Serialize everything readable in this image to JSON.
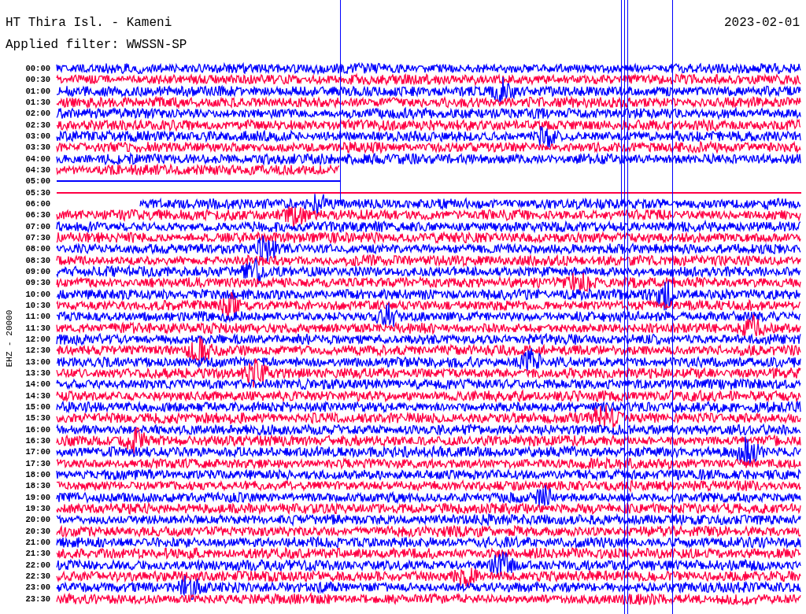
{
  "header": {
    "station": "HT Thira Isl. - Kameni",
    "date": "2023-02-01",
    "filter": "Applied filter: WWSSN-SP"
  },
  "channel_label": "EHZ - 20000",
  "rows": [
    {
      "time": "00:00",
      "color": "#0000ff",
      "kind": "trace"
    },
    {
      "time": "00:30",
      "color": "#ff0044",
      "kind": "trace"
    },
    {
      "time": "01:00",
      "color": "#0000ff",
      "kind": "trace"
    },
    {
      "time": "01:30",
      "color": "#ff0044",
      "kind": "trace"
    },
    {
      "time": "02:00",
      "color": "#0000ff",
      "kind": "trace"
    },
    {
      "time": "02:30",
      "color": "#ff0044",
      "kind": "trace"
    },
    {
      "time": "03:00",
      "color": "#0000ff",
      "kind": "trace"
    },
    {
      "time": "03:30",
      "color": "#ff0044",
      "kind": "trace"
    },
    {
      "time": "04:00",
      "color": "#0000ff",
      "kind": "trace"
    },
    {
      "time": "04:30",
      "color": "#ff0044",
      "kind": "trace"
    },
    {
      "time": "05:00",
      "color": "#0000ff",
      "kind": "flat"
    },
    {
      "time": "05:30",
      "color": "#ff0044",
      "kind": "flat"
    },
    {
      "time": "06:00",
      "color": "#0000ff",
      "kind": "trace"
    },
    {
      "time": "06:30",
      "color": "#ff0044",
      "kind": "trace"
    },
    {
      "time": "07:00",
      "color": "#0000ff",
      "kind": "trace"
    },
    {
      "time": "07:30",
      "color": "#ff0044",
      "kind": "trace"
    },
    {
      "time": "08:00",
      "color": "#0000ff",
      "kind": "trace"
    },
    {
      "time": "08:30",
      "color": "#ff0044",
      "kind": "trace"
    },
    {
      "time": "09:00",
      "color": "#0000ff",
      "kind": "trace"
    },
    {
      "time": "09:30",
      "color": "#ff0044",
      "kind": "trace"
    },
    {
      "time": "10:00",
      "color": "#0000ff",
      "kind": "trace"
    },
    {
      "time": "10:30",
      "color": "#ff0044",
      "kind": "trace"
    },
    {
      "time": "11:00",
      "color": "#0000ff",
      "kind": "trace"
    },
    {
      "time": "11:30",
      "color": "#ff0044",
      "kind": "trace"
    },
    {
      "time": "12:00",
      "color": "#0000ff",
      "kind": "trace"
    },
    {
      "time": "12:30",
      "color": "#ff0044",
      "kind": "trace"
    },
    {
      "time": "13:00",
      "color": "#0000ff",
      "kind": "trace"
    },
    {
      "time": "13:30",
      "color": "#ff0044",
      "kind": "trace"
    },
    {
      "time": "14:00",
      "color": "#0000ff",
      "kind": "trace"
    },
    {
      "time": "14:30",
      "color": "#ff0044",
      "kind": "trace"
    },
    {
      "time": "15:00",
      "color": "#0000ff",
      "kind": "trace"
    },
    {
      "time": "15:30",
      "color": "#ff0044",
      "kind": "trace"
    },
    {
      "time": "16:00",
      "color": "#0000ff",
      "kind": "trace"
    },
    {
      "time": "16:30",
      "color": "#ff0044",
      "kind": "trace"
    },
    {
      "time": "17:00",
      "color": "#0000ff",
      "kind": "trace"
    },
    {
      "time": "17:30",
      "color": "#ff0044",
      "kind": "trace"
    },
    {
      "time": "18:00",
      "color": "#0000ff",
      "kind": "trace"
    },
    {
      "time": "18:30",
      "color": "#ff0044",
      "kind": "trace"
    },
    {
      "time": "19:00",
      "color": "#0000ff",
      "kind": "trace"
    },
    {
      "time": "19:30",
      "color": "#ff0044",
      "kind": "trace"
    },
    {
      "time": "20:00",
      "color": "#0000ff",
      "kind": "trace"
    },
    {
      "time": "20:30",
      "color": "#ff0044",
      "kind": "trace"
    },
    {
      "time": "21:00",
      "color": "#0000ff",
      "kind": "trace"
    },
    {
      "time": "21:30",
      "color": "#ff0044",
      "kind": "trace"
    },
    {
      "time": "22:00",
      "color": "#0000ff",
      "kind": "trace"
    },
    {
      "time": "22:30",
      "color": "#ff0044",
      "kind": "trace"
    },
    {
      "time": "23:00",
      "color": "#0000ff",
      "kind": "trace"
    },
    {
      "time": "23:30",
      "color": "#ff0044",
      "kind": "trace"
    }
  ]
}
